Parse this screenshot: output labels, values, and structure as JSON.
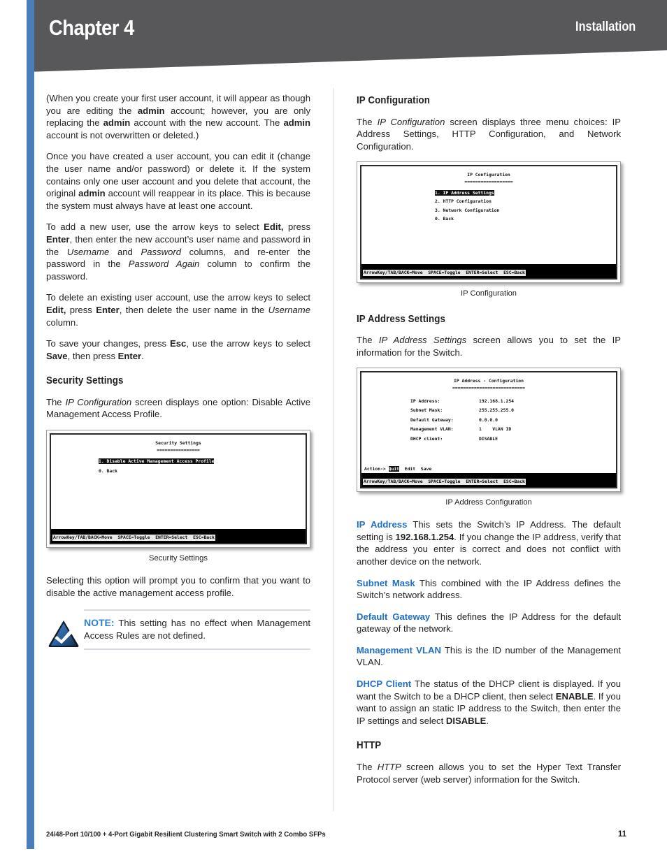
{
  "header": {
    "chapter": "Chapter 4",
    "section": "Installation",
    "bar_color": "#58585b",
    "accent_color": "#4a7ebb"
  },
  "left_column": {
    "p1_pre": "(When you create your first user account, it will appear as though you are editing the ",
    "p1_b1": "admin",
    "p1_mid1": " account; however, you are only replacing the ",
    "p1_b2": "admin",
    "p1_mid2": " account with the new account. The ",
    "p1_b3": "admin",
    "p1_end": " account is not overwritten or deleted.)",
    "p2_pre": "Once you have created a user account, you can edit it (change the user name and/or password) or delete it. If the system contains only one user account and you delete that account, the original ",
    "p2_b1": "admin",
    "p2_end": " account will reappear in its place. This is because the system must always have at least one account.",
    "p3_pre": "To add a new user, use the arrow keys to select ",
    "p3_b1": "Edit,",
    "p3_mid1": " press ",
    "p3_b2": "Enter",
    "p3_mid2": ", then enter the new account’s user name and password in the ",
    "p3_i1": "Username",
    "p3_mid3": " and ",
    "p3_i2": "Password",
    "p3_mid4": " columns, and re-enter the password in the ",
    "p3_i3": "Password Again",
    "p3_end": " column to confirm the password.",
    "p4_pre": "To delete an existing user account, use the arrow keys to select ",
    "p4_b1": "Edit,",
    "p4_mid1": " press ",
    "p4_b2": "Enter",
    "p4_mid2": ", then delete the user name in the ",
    "p4_i1": "Username",
    "p4_end": " column.",
    "p5_pre": "To save your changes, press ",
    "p5_b1": "Esc",
    "p5_mid1": ", use the arrow keys to select ",
    "p5_b2": "Save",
    "p5_mid2": ", then press ",
    "p5_b3": "Enter",
    "p5_end": ".",
    "heading_security": "Security Settings",
    "p6_pre": "The ",
    "p6_i1": "IP Configuration",
    "p6_end": " screen displays one option: Disable Active Management Access Profile.",
    "security_figure": {
      "title": "Security Settings",
      "underline": "================",
      "menu_highlight": "1. Disable Active Management Access Profile",
      "menu_item_2": "0. Back",
      "status_bar": "ArrowKey/TAB/BACK=Move  SPACE=Toggle  ENTER=Select  ESC=Back",
      "caption": "Security Settings"
    },
    "p7": "Selecting this option will prompt you to confirm that you want to disable the active management access profile.",
    "note": {
      "label": "NOTE:",
      "text": " This setting has no effect when Management Access Rules are not defined.",
      "icon": "check-triangle-icon"
    }
  },
  "right_column": {
    "heading_ip_config": "IP Configuration",
    "p1_pre": "The ",
    "p1_i1": "IP Configuration",
    "p1_end": " screen displays three menu choices: IP Address Settings, HTTP Configuration, and Network Configuration.",
    "ip_config_figure": {
      "title": "IP Configuration",
      "underline": "==================",
      "menu_highlight": "1. IP Address Settings",
      "menu_item_2": "2. HTTP Configuration",
      "menu_item_3": "3. Network Configuration",
      "menu_item_4": "0. Back",
      "status_bar": "ArrowKey/TAB/BACK=Move  SPACE=Toggle  ENTER=Select  ESC=Back",
      "caption": "IP Configuration"
    },
    "heading_ip_address_settings": "IP Address Settings",
    "p2_pre": "The ",
    "p2_i1": "IP Address Settings",
    "p2_end": " screen allows you to set the IP information for the Switch.",
    "ip_address_figure": {
      "title": "IP Address - Configuration",
      "underline": "===========================",
      "rows": [
        {
          "label": "IP Address:",
          "value": "192.168.1.254"
        },
        {
          "label": "Subnet Mask:",
          "value": "255.255.255.0"
        },
        {
          "label": "Default Gateway:",
          "value": "0.0.0.0"
        },
        {
          "label": "Management VLAN:",
          "value": "1    VLAN ID"
        },
        {
          "label": "DHCP client:",
          "value": "DISABLE"
        }
      ],
      "action_prefix": "Action-> ",
      "action_highlight": "Quit",
      "action_rest": "  Edit  Save",
      "status_bar": "ArrowKey/TAB/BACK=Move  SPACE=Toggle  ENTER=Select  ESC=Back",
      "caption": "IP Address Configuration"
    },
    "d1_kw": "IP Address",
    "d1_pre": "  This sets the Switch’s IP Address. The default setting is ",
    "d1_b1": "192.168.1.254",
    "d1_end": ". If you change the IP address, verify that the address you enter is correct and does not conflict with another device on the network.",
    "d2_kw": "Subnet Mask",
    "d2_text": "  This combined with the IP Address defines the Switch’s network address.",
    "d3_kw": "Default Gateway",
    "d3_text": " This defines the IP Address for the default gateway of the network.",
    "d4_kw": "Management VLAN",
    "d4_text": " This is the ID number of the Management VLAN.",
    "d5_kw": "DHCP Client",
    "d5_pre": "  The status of the DHCP client is displayed. If you want the Switch to be a DHCP client, then select ",
    "d5_b1": "ENABLE",
    "d5_mid": ". If you want to assign an static IP address to the Switch, then enter the IP settings and select ",
    "d5_b2": "DISABLE",
    "d5_end": ".",
    "heading_http": "HTTP",
    "p3_pre": "The ",
    "p3_i1": "HTTP",
    "p3_end": " screen allows you to set the Hyper Text Transfer Protocol server (web server) information for the Switch."
  },
  "footer": {
    "text": "24/48-Port 10/100 + 4-Port Gigabit Resilient Clustering Smart Switch with 2 Combo SFPs",
    "page_number": "11"
  }
}
